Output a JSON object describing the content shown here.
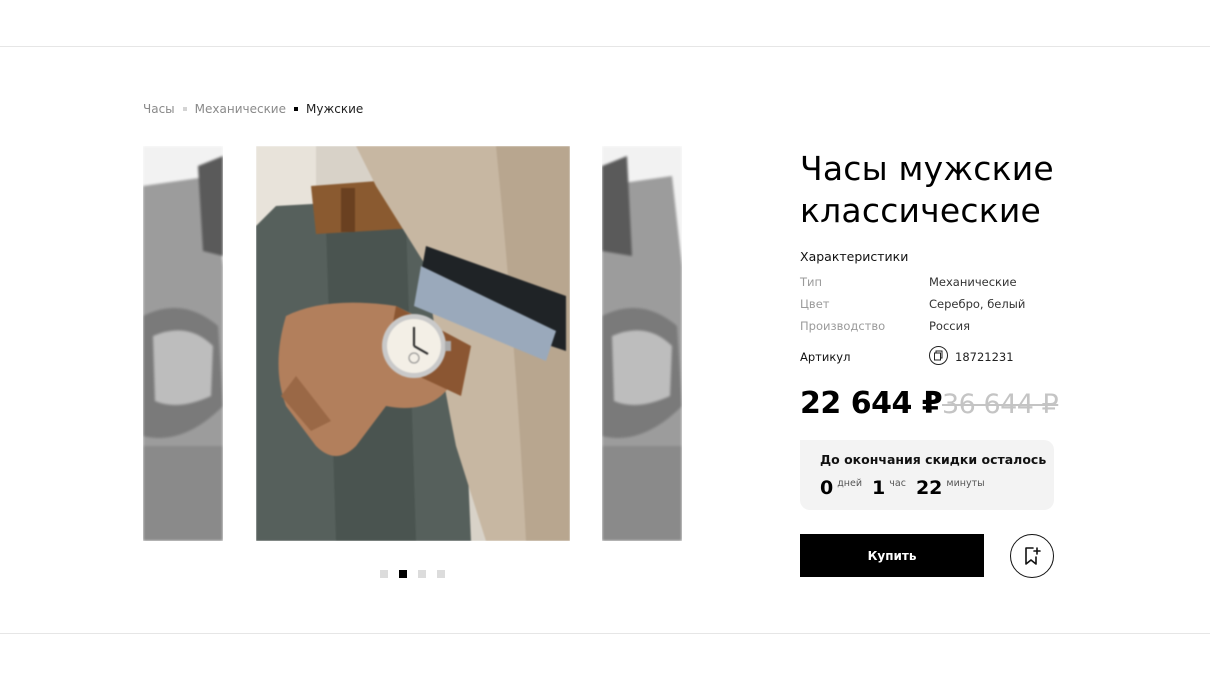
{
  "breadcrumb": {
    "items": [
      "Часы",
      "Механические",
      "Мужские"
    ]
  },
  "gallery": {
    "slides": [
      "side-slide-left",
      "main-slide",
      "side-slide-right"
    ],
    "dots_total": 4,
    "active_dot": 2
  },
  "product": {
    "title": "Часы мужские классические",
    "specs_heading": "Характеристики",
    "specs": [
      {
        "key": "Тип",
        "value": "Механические"
      },
      {
        "key": "Цвет",
        "value": "Серебро, белый"
      },
      {
        "key": "Производство",
        "value": "Россия"
      }
    ],
    "article_label": "Артикул",
    "article_value": "18721231",
    "price": "22 644 ₽",
    "old_price": "36 644 ₽"
  },
  "timer": {
    "title": "До окончания скидки осталось",
    "days": "0",
    "days_label": "дней",
    "hours": "1",
    "hours_label": "час",
    "minutes": "22",
    "minutes_label": "минуты"
  },
  "actions": {
    "buy_label": "Купить",
    "bookmark_icon": "bookmark-add-icon"
  },
  "colors": {
    "accent": "#000000",
    "muted_text": "#9a9a9a",
    "old_price": "#c4c4c4",
    "timer_bg": "#f3f3f3"
  }
}
